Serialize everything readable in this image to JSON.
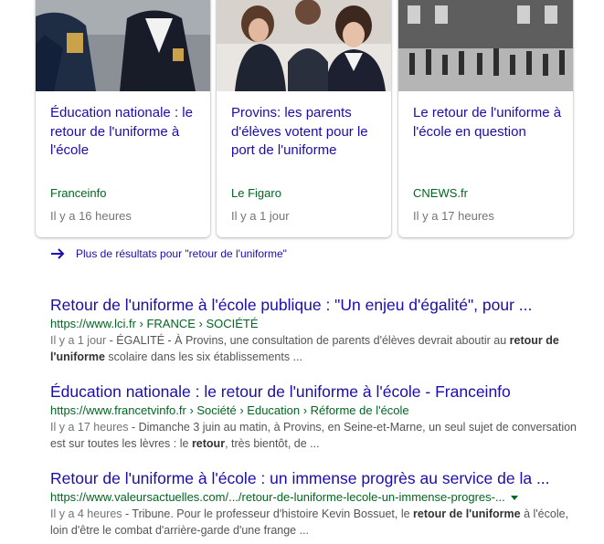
{
  "news_cards": [
    {
      "title": "Éducation nationale : le retour de l'uniforme à l'école",
      "source": "Franceinfo",
      "time": "Il y a 16 heures"
    },
    {
      "title": "Provins: les parents d'élèves votent pour le port de l'uniforme",
      "source": "Le Figaro",
      "time": "Il y a 1 jour"
    },
    {
      "title": "Le retour de l'uniforme à l'école en question",
      "source": "CNEWS.fr",
      "time": "Il y a 17 heures"
    }
  ],
  "more_results": {
    "label": "Plus de résultats pour \"retour de l'uniforme\"",
    "icon": "arrow-right-icon"
  },
  "results": [
    {
      "title": "Retour de l'uniforme à l'école publique : \"Un enjeu d'égalité\", pour ...",
      "url": "https://www.lci.fr › FRANCE › SOCIÉTÉ",
      "date": "Il y a 1 jour",
      "snippet_a": " - ÉGALITÉ - À Provins, une consultation de parents d'élèves devrait aboutir au ",
      "bold1": "retour de l'uniforme",
      "snippet_b": " scolaire dans les six établissements ..."
    },
    {
      "title": "Éducation nationale : le retour de l'uniforme à l'école - Franceinfo",
      "url": "https://www.francetvinfo.fr › Société › Education › Réforme de l'école",
      "date": "Il y a 17 heures",
      "snippet_a": " - Dimanche 3 juin au matin, à Provins, en Seine-et-Marne, un seul sujet de conversation est sur toutes les lèvres : le ",
      "bold1": "retour",
      "snippet_b": ", très bientôt, de ..."
    },
    {
      "title": "Retour de l'uniforme à l'école : un immense progrès au service de la ...",
      "url": "https://www.valeursactuelles.com/.../retour-de-luniforme-lecole-un-immense-progres-...",
      "date": "Il y a 4 heures",
      "snippet_a": " - Tribune. Pour le professeur d'histoire Kevin Bossuet, le ",
      "bold1": "retour de l'uniforme",
      "snippet_b": " à l'école, loin d'être le combat d'arrière-garde d'une frange ..."
    }
  ],
  "colors": {
    "link": "#1a0dab",
    "url": "#006621",
    "snippet": "#545454",
    "meta": "#70757a"
  }
}
